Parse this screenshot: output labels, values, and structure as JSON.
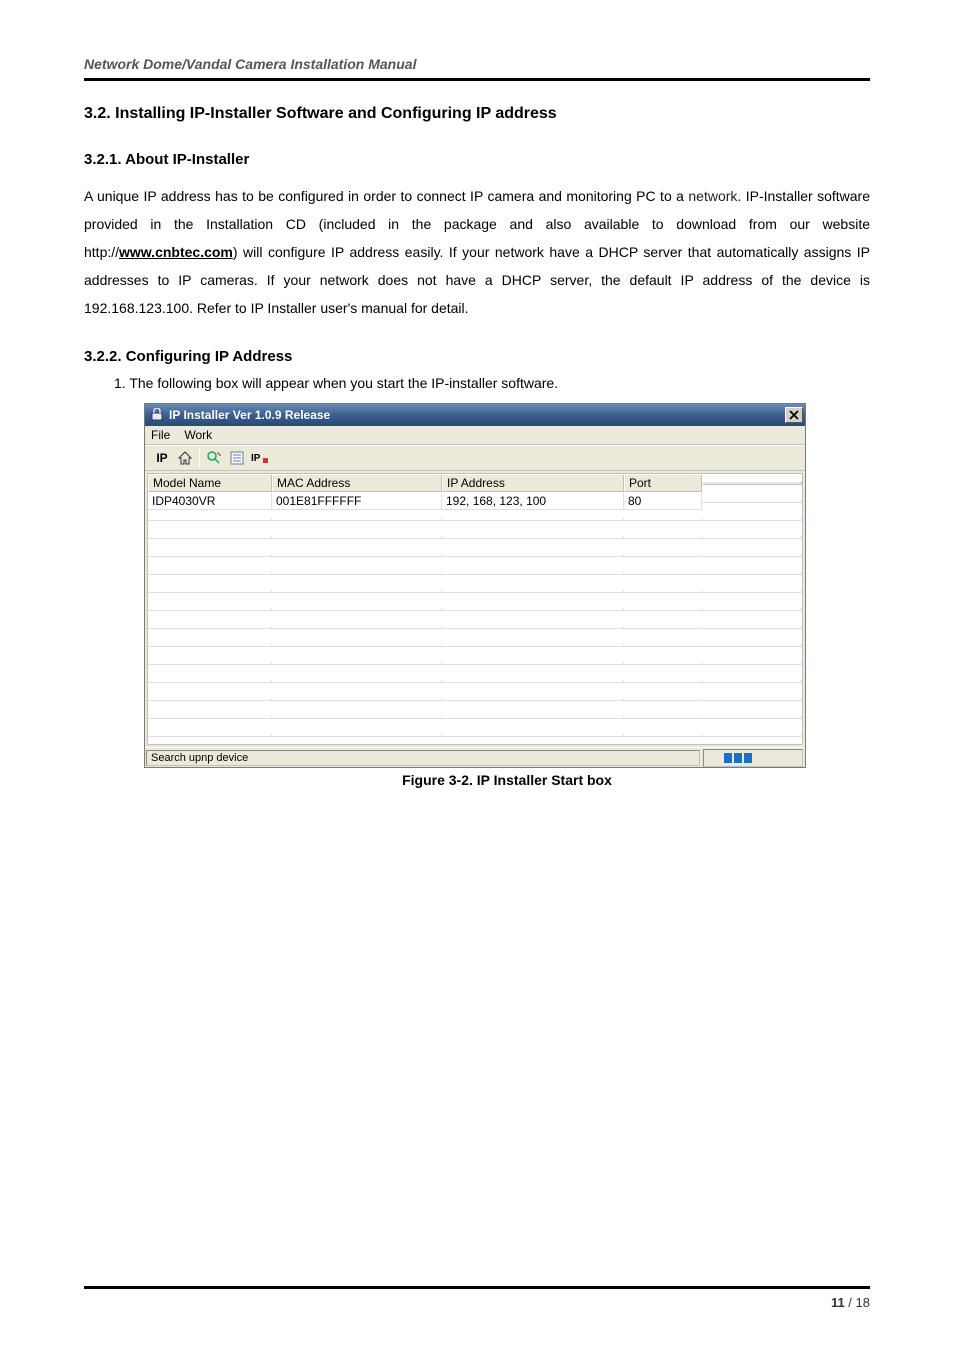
{
  "doc": {
    "header": "Network Dome/Vandal Camera Installation Manual",
    "section_title": "3.2. Installing IP-Installer Software and Configuring IP address",
    "sub1_title": "3.2.1. About IP-Installer",
    "sub1_body_pre": "A unique IP address has to be configured in order to connect IP camera and monitoring PC to a ",
    "sub1_body_network": "network",
    "sub1_body_mid1": ". IP-Installer software provided in the Installation CD (included in the package and also available to download from our website http://",
    "sub1_link": "www.cnbtec.com",
    "sub1_body_mid2": ") will configure IP address easily. If your network have a DHCP server that automatically assigns IP addresses to IP cameras. If your network does not have a DHCP server, the default IP address of the device is 192.168.123.100. Refer to IP Installer user's manual for detail.",
    "sub2_title": "3.2.2. Configuring IP Address",
    "sub2_item1": "1. The following box will appear when you start the IP-installer software.",
    "figure_caption": "Figure 3-2. IP Installer Start box",
    "page_current": "11",
    "page_sep": " / ",
    "page_total": "18"
  },
  "app": {
    "title": "IP Installer Ver 1.0.9 Release",
    "menus": {
      "file": "File",
      "work": "Work"
    },
    "toolbar": {
      "ip_label": "IP",
      "icons": [
        "home-icon",
        "search-refresh-icon",
        "list-icon",
        "ip-config-icon"
      ]
    },
    "columns": {
      "model": "Model Name",
      "mac": "MAC Address",
      "ip": "IP Address",
      "port": "Port"
    },
    "rows": [
      {
        "model": "IDP4030VR",
        "mac": "001E81FFFFFF",
        "ip": "192, 168, 123, 100",
        "port": "80"
      }
    ],
    "status_text": "Search upnp device"
  }
}
